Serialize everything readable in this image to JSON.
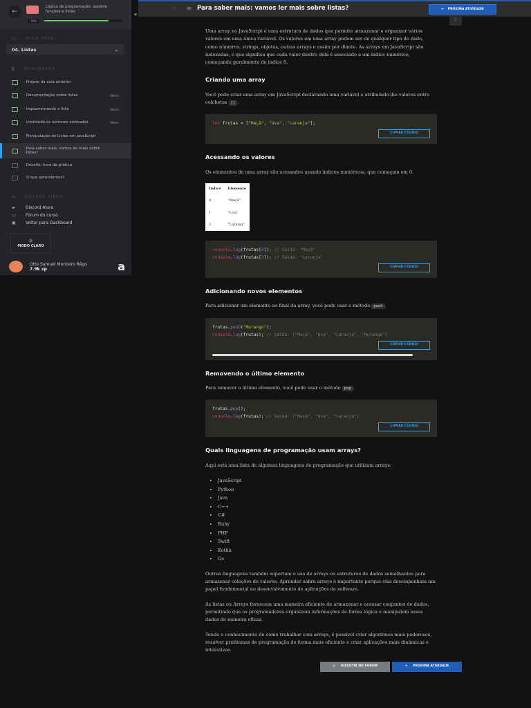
{
  "sidebar": {
    "course_title": "Lógica de programação: explore funções e listas",
    "progress_label": "78%",
    "progress": 0.82,
    "current_section_label": "AULA ATUAL",
    "current_lesson": "04. Listas",
    "activities_label": "ATIVIDADES",
    "activities": [
      {
        "label": "Projeto da aula anterior",
        "duration": ""
      },
      {
        "label": "Documentação sobre listas",
        "duration": "08min"
      },
      {
        "label": "Implementando a lista",
        "duration": "08min"
      },
      {
        "label": "Limitando os números sorteados",
        "duration": "08min"
      },
      {
        "label": "Manipulação de Listas em JavaScript",
        "duration": ""
      },
      {
        "label": "Para saber mais: vamos ler mais sobre listas?",
        "duration": ""
      },
      {
        "label": "Desafio: hora da prática",
        "duration": ""
      },
      {
        "label": "O que aprendemos?",
        "duration": ""
      }
    ],
    "other_links_label": "OUTROS LINKS",
    "links": [
      "Discord Alura",
      "Fórum do curso",
      "Voltar para Dashboard"
    ],
    "mode_label": "MODO CLARO",
    "user_name": "Otto Samuel Monteiro Rêgo",
    "user_xp": "7.9k xp"
  },
  "topbar": {
    "number": "06",
    "title": "Para saber mais: vamos ler mais sobre listas?",
    "next_label": "PRÓXIMA ATIVIDADE"
  },
  "content": {
    "intro": "Uma array no JavaScript é uma estrutura de dados que permite armazenar e organizar vários valores em uma única variável. Os valores em uma array podem ser de qualquer tipo de dado, como números, strings, objetos, outras arrays e assim por diante. As arrays em JavaScript são indexadas, o que significa que cada valor dentro dela é associado a um índice numérico, começando geralmente do índice 0.",
    "h_create": "Criando uma array",
    "p_create": "Você pode criar uma array em JavaScript declarando uma variável e atribuindo-lhe valores entre colchetes",
    "brackets": "[]",
    "copy_label": "COPIAR CÓDIGO",
    "h_access": "Acessando os valores",
    "p_access": "Os elementos de uma array são acessados usando índices numéricos, que começam em 0.",
    "table": {
      "headers": [
        "Índice",
        "Elemento"
      ],
      "rows": [
        [
          "0",
          "\"Maçã\""
        ],
        [
          "1",
          "\"Uva\""
        ],
        [
          "2",
          "\"Laranja\""
        ]
      ]
    },
    "h_add": "Adicionando novos elementos",
    "p_add": "Para adicionar um elemento ao final da array, você pode usar o método",
    "push": "push",
    "h_remove": "Removendo o último elemento",
    "p_remove": "Para remover o último elemento, você pode usar o método",
    "pop": "pop",
    "h_langs": "Quais linguagens de programação usam arrays?",
    "p_langs": "Aqui está uma lista de algumas linguagens de programação que utilizam arrays:",
    "languages": [
      "JavaScript",
      "Python",
      "Java",
      "C++",
      "C#",
      "Ruby",
      "PHP",
      "Swift",
      "Kotlin",
      "Go"
    ],
    "p1": "Outras linguagens também suportam o uso de arrays ou estruturas de dados semelhantes para armazenar coleções de valores. Aprender sobre arrays é importante porque elas desempenham um papel fundamental no desenvolvimento de aplicações de software.",
    "p2": "As listas ou Arrays fornecem uma maneira eficiente de armazenar e acessar conjuntos de dados, permitindo que os programadores organizem informações de forma lógica e manipulem esses dados de maneira eficaz.",
    "p3": "Tendo o conhecimento de como trabalhar com arrays, é possível criar algoritmos mais poderosos, resolver problemas de programação de forma mais eficiente e criar aplicações mais dinâmicas e interativas.",
    "forum_label": "DISCUTIR NO FORUM",
    "next_label": "PRÓXIMA ATIVIDADE"
  }
}
